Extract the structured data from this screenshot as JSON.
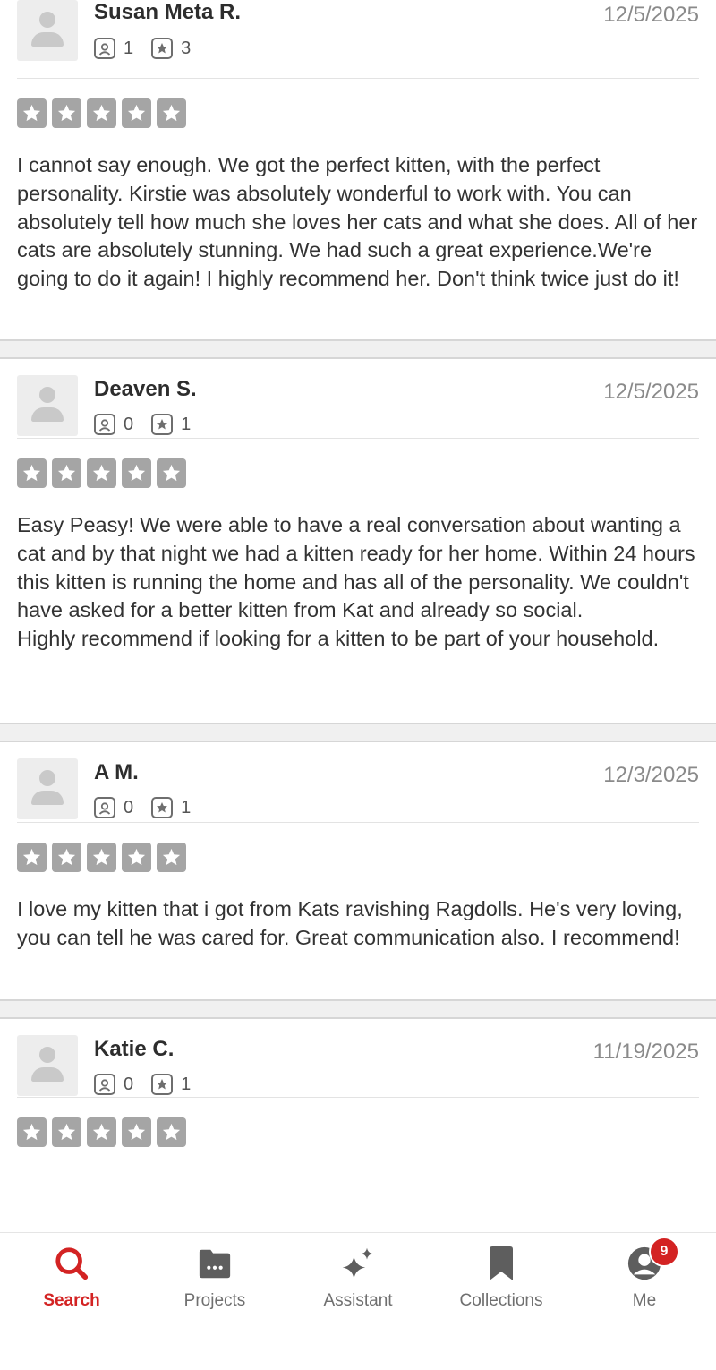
{
  "colors": {
    "accent": "#d32323",
    "star_gray": "#a5a5a5",
    "text": "#333333",
    "date": "#8a8a8a"
  },
  "reviews": [
    {
      "name": "Susan Meta R.",
      "date": "12/5/2025",
      "photos": "1",
      "reviews_count": "3",
      "rating": 5,
      "text": "I cannot say enough. We got the perfect kitten, with the perfect personality. Kirstie was absolutely wonderful to work with. You can absolutely tell how much she loves her cats and what she does. All of her cats are absolutely stunning. We had such a great experience.We're going to do it again! I highly recommend her. Don't think twice just do it!"
    },
    {
      "name": "Deaven S.",
      "date": "12/5/2025",
      "photos": "0",
      "reviews_count": "1",
      "rating": 5,
      "text": "Easy Peasy! We were able to have a real conversation about wanting a cat and by that night we had a kitten ready for her home. Within 24 hours this kitten is running the home and has all of the personality. We couldn't have asked for a better kitten from Kat and already so social.\nHighly recommend if looking for a kitten to be part of your household."
    },
    {
      "name": "A M.",
      "date": "12/3/2025",
      "photos": "0",
      "reviews_count": "1",
      "rating": 5,
      "text": "I love my kitten that i got from Kats ravishing Ragdolls. He's very loving, you can tell he was cared for. Great communication also. I recommend!"
    },
    {
      "name": "Katie C.",
      "date": "11/19/2025",
      "photos": "0",
      "reviews_count": "1",
      "rating": 5,
      "text": ""
    }
  ],
  "tabbar": {
    "search": "Search",
    "projects": "Projects",
    "assistant": "Assistant",
    "collections": "Collections",
    "me": "Me",
    "me_badge": "9",
    "icons": [
      "search-icon",
      "briefcase-icon",
      "sparkle-icon",
      "bookmark-icon",
      "user-icon"
    ]
  }
}
